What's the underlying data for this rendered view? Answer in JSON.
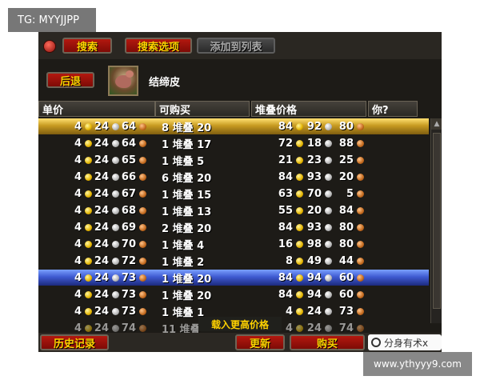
{
  "corner_tag": "TG: MYYJJPP",
  "watermark_url": "www.ythyyy9.com",
  "toolbar": {
    "search_label": "搜索",
    "search_options_label": "搜索选项",
    "add_to_list_label": "添加到列表"
  },
  "back_label": "后退",
  "item": {
    "name": "结缔皮",
    "icon": "creature-portrait-icon"
  },
  "headers": {
    "unit_price": "单价",
    "available": "可购买",
    "stack_price": "堆叠价格",
    "yours": "你?"
  },
  "rows": [
    {
      "ug": "4",
      "us": "24",
      "uc": "64",
      "avail": "8 堆叠 20",
      "sg": "84",
      "ss": "92",
      "sc": "80"
    },
    {
      "ug": "4",
      "us": "24",
      "uc": "64",
      "avail": "1 堆叠 17",
      "sg": "72",
      "ss": "18",
      "sc": "88"
    },
    {
      "ug": "4",
      "us": "24",
      "uc": "65",
      "avail": "1 堆叠 5",
      "sg": "21",
      "ss": "23",
      "sc": "25"
    },
    {
      "ug": "4",
      "us": "24",
      "uc": "66",
      "avail": "6 堆叠 20",
      "sg": "84",
      "ss": "93",
      "sc": "20"
    },
    {
      "ug": "4",
      "us": "24",
      "uc": "67",
      "avail": "1 堆叠 15",
      "sg": "63",
      "ss": "70",
      "sc": "5"
    },
    {
      "ug": "4",
      "us": "24",
      "uc": "68",
      "avail": "1 堆叠 13",
      "sg": "55",
      "ss": "20",
      "sc": "84"
    },
    {
      "ug": "4",
      "us": "24",
      "uc": "69",
      "avail": "2 堆叠 20",
      "sg": "84",
      "ss": "93",
      "sc": "80"
    },
    {
      "ug": "4",
      "us": "24",
      "uc": "70",
      "avail": "1 堆叠 4",
      "sg": "16",
      "ss": "98",
      "sc": "80"
    },
    {
      "ug": "4",
      "us": "24",
      "uc": "72",
      "avail": "1 堆叠 2",
      "sg": "8",
      "ss": "49",
      "sc": "44"
    },
    {
      "ug": "4",
      "us": "24",
      "uc": "73",
      "avail": "1 堆叠 20",
      "sg": "84",
      "ss": "94",
      "sc": "60"
    },
    {
      "ug": "4",
      "us": "24",
      "uc": "73",
      "avail": "1 堆叠 20",
      "sg": "84",
      "ss": "94",
      "sc": "60"
    },
    {
      "ug": "4",
      "us": "24",
      "uc": "73",
      "avail": "1 堆叠 1",
      "sg": "4",
      "ss": "24",
      "sc": "73"
    },
    {
      "ug": "4",
      "us": "24",
      "uc": "74",
      "avail": "11 堆叠",
      "sg": "4",
      "ss": "24",
      "sc": "74"
    }
  ],
  "load_more_label": "载入更高价格",
  "bottom": {
    "history_label": "历史记录",
    "refresh_label": "更新",
    "buy_label": "购买",
    "weibo_text": "分身有术x"
  },
  "colors": {
    "highlight_gold": "#c79a21",
    "highlight_blue": "#3f5bd2",
    "button_red": "#9b110a",
    "label_yellow": "#ffd200"
  }
}
